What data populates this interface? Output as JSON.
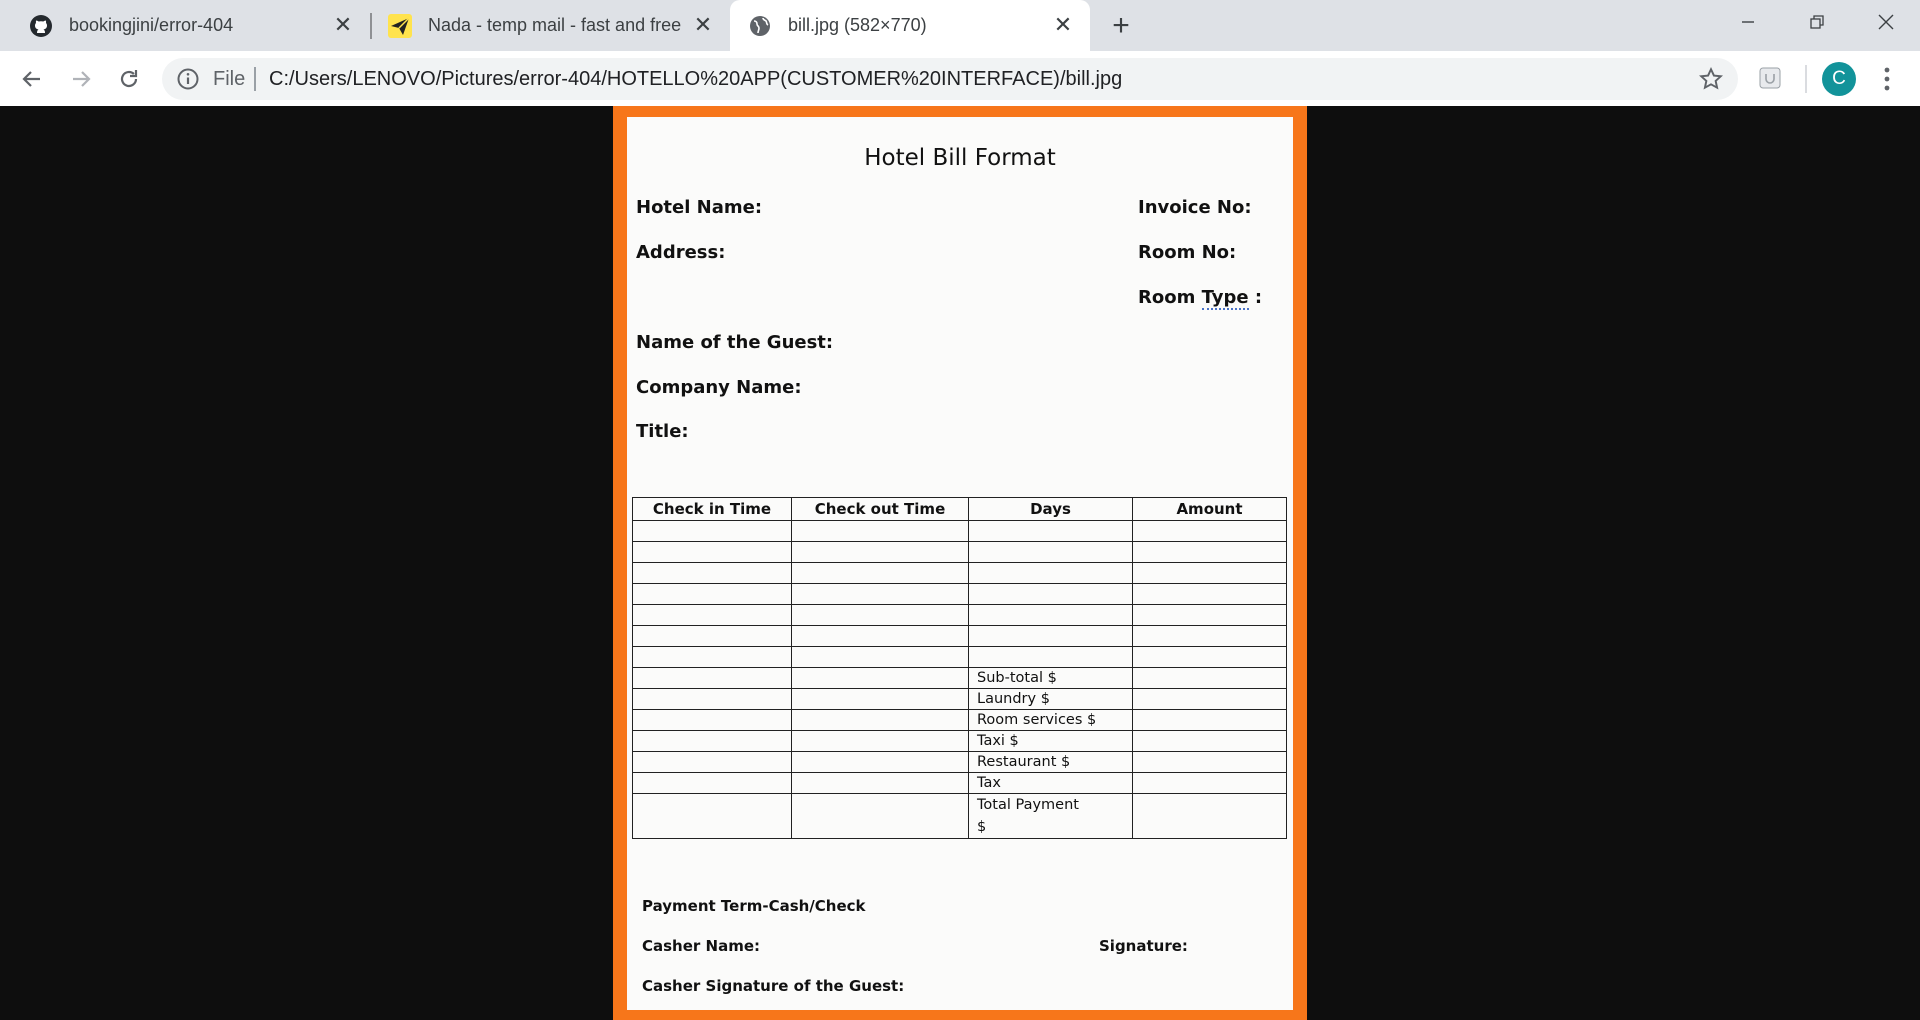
{
  "browser": {
    "tabs": [
      {
        "title": "bookingjini/error-404",
        "icon": "github-icon",
        "active": false
      },
      {
        "title": "Nada - temp mail - fast and free",
        "icon": "paper-plane-icon",
        "active": false
      },
      {
        "title": "bill.jpg (582×770)",
        "icon": "globe-icon",
        "active": true
      }
    ],
    "address": {
      "scheme": "File",
      "url": "C:/Users/LENOVO/Pictures/error-404/HOTELLO%20APP(CUSTOMER%20INTERFACE)/bill.jpg"
    },
    "profile_initial": "C",
    "colors": {
      "frame": "#dee1e6",
      "accent_border": "#f7761a",
      "avatar": "#12939a"
    }
  },
  "bill": {
    "title": "Hotel Bill Format",
    "labels": {
      "hotel_name": "Hotel Name:",
      "invoice_no": "Invoice No:",
      "address": "Address:",
      "room_no": "Room No:",
      "room_type_word": "Room",
      "room_type_squig": "Type",
      "room_type_colon": " :",
      "guest_name": "Name of the Guest:",
      "company_name": "Company Name:",
      "title": "Title:"
    },
    "table": {
      "headers": [
        "Check in Time",
        "Check out Time",
        "Days",
        "Amount"
      ],
      "empty_rows": 7,
      "charges": [
        "Sub-total $",
        "Laundry $",
        "Room services $",
        "Taxi $",
        "Restaurant $",
        "Tax"
      ],
      "total_line1": "Total Payment",
      "total_line2": "$"
    },
    "footer": {
      "payment_term": "Payment Term-Cash/Check",
      "casher_name": "Casher Name:",
      "signature": "Signature:",
      "casher_signature": "Casher Signature of the Guest:"
    }
  }
}
